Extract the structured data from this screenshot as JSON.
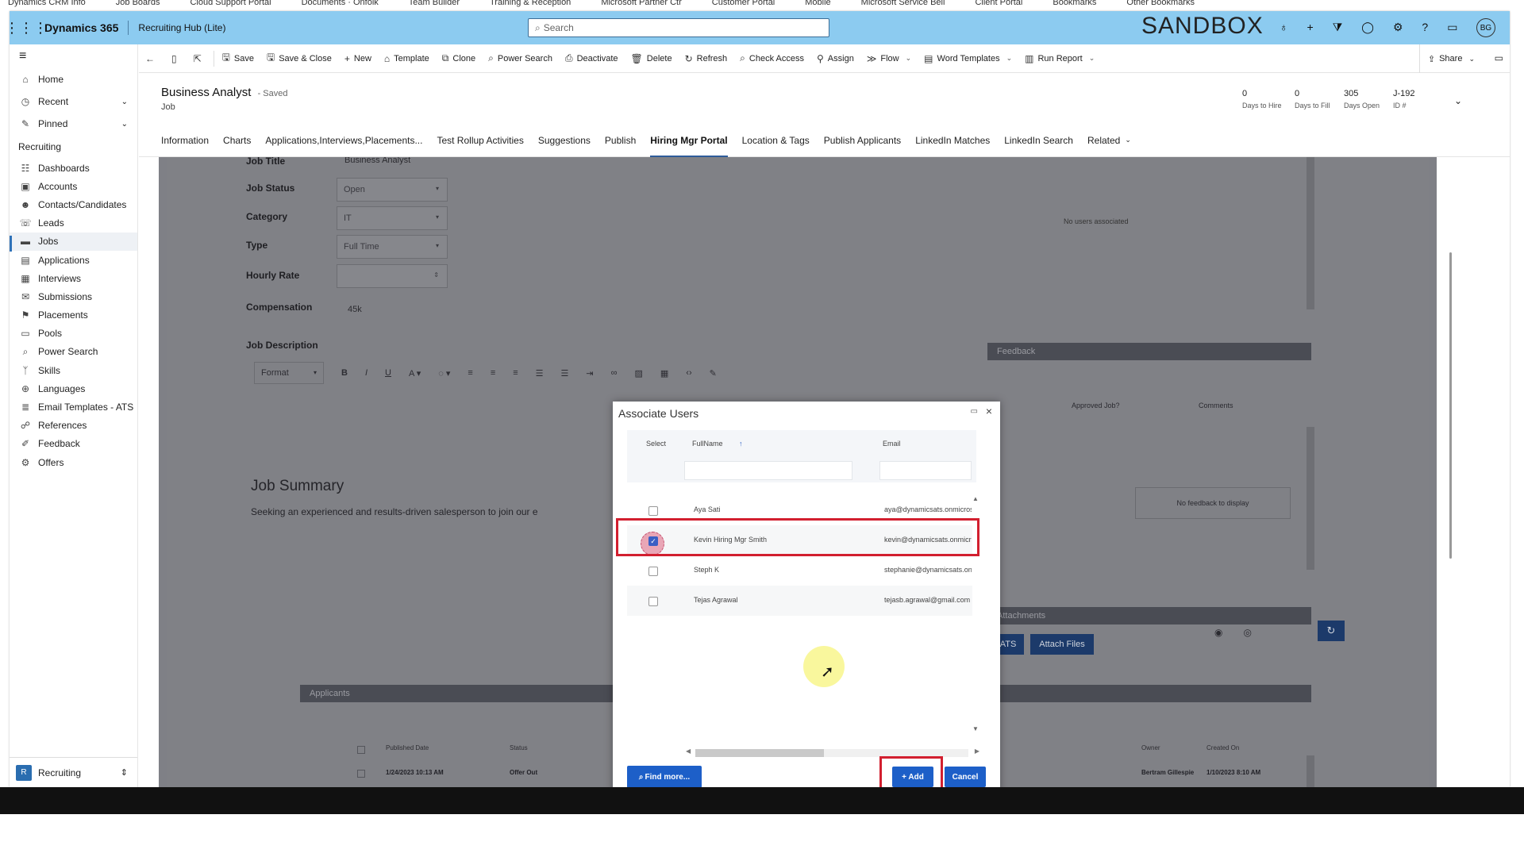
{
  "bookmarks": [
    "Dynamics CRM Info",
    "Job Boards",
    "Cloud Support Portal",
    "Documents · Onfolk",
    "Team Builder",
    "Training & Reception",
    "Microsoft Partner Ctr",
    "Customer Portal",
    "Mobile",
    "Microsoft Service Bell",
    "Client Portal",
    "Bookmarks",
    "Other Bookmarks"
  ],
  "topbar": {
    "brand": "Dynamics 365",
    "app_name": "Recruiting Hub (Lite)",
    "search_placeholder": "Search",
    "environment": "SANDBOX",
    "avatar_initials": "BG",
    "icons": [
      "lightbulb-icon",
      "plus-icon",
      "filter-icon",
      "bell-icon",
      "gear-icon",
      "help-icon",
      "chat-icon"
    ]
  },
  "sidebar": {
    "top": [
      {
        "label": "Home",
        "icon": "⌂",
        "name": "home"
      },
      {
        "label": "Recent",
        "icon": "◷",
        "name": "recent",
        "chevron": "⌄"
      },
      {
        "label": "Pinned",
        "icon": "✎",
        "name": "pinned",
        "chevron": "⌄"
      }
    ],
    "group_label": "Recruiting",
    "items": [
      {
        "label": "Dashboards",
        "icon": "☷",
        "name": "dashboards"
      },
      {
        "label": "Accounts",
        "icon": "▣",
        "name": "accounts"
      },
      {
        "label": "Contacts/Candidates",
        "icon": "☻",
        "name": "contacts-candidates"
      },
      {
        "label": "Leads",
        "icon": "☏",
        "name": "leads"
      },
      {
        "label": "Jobs",
        "icon": "▬",
        "name": "jobs",
        "active": true
      },
      {
        "label": "Applications",
        "icon": "▤",
        "name": "applications"
      },
      {
        "label": "Interviews",
        "icon": "▦",
        "name": "interviews"
      },
      {
        "label": "Submissions",
        "icon": "✉",
        "name": "submissions"
      },
      {
        "label": "Placements",
        "icon": "⚑",
        "name": "placements"
      },
      {
        "label": "Pools",
        "icon": "▭",
        "name": "pools"
      },
      {
        "label": "Power Search",
        "icon": "⌕",
        "name": "power-search"
      },
      {
        "label": "Skills",
        "icon": "ᛉ",
        "name": "skills"
      },
      {
        "label": "Languages",
        "icon": "⊕",
        "name": "languages"
      },
      {
        "label": "Email Templates - ATS",
        "icon": "≣",
        "name": "email-templates"
      },
      {
        "label": "References",
        "icon": "☍",
        "name": "references"
      },
      {
        "label": "Feedback",
        "icon": "✐",
        "name": "feedback"
      },
      {
        "label": "Offers",
        "icon": "⚙",
        "name": "offers"
      }
    ],
    "area": {
      "badge": "R",
      "label": "Recruiting",
      "chevron": "⇕"
    }
  },
  "commandbar": [
    {
      "label": "",
      "icon": "←",
      "name": "back"
    },
    {
      "label": "",
      "icon": "▯",
      "name": "record-icon-btn"
    },
    {
      "label": "",
      "icon": "⇱",
      "name": "popout"
    },
    {
      "label": "Save",
      "icon": "🖫",
      "name": "save"
    },
    {
      "label": "Save & Close",
      "icon": "🖫",
      "name": "save-close"
    },
    {
      "label": "New",
      "icon": "+",
      "name": "new"
    },
    {
      "label": "Template",
      "icon": "⌂",
      "name": "template"
    },
    {
      "label": "Clone",
      "icon": "⧉",
      "name": "clone"
    },
    {
      "label": "Power Search",
      "icon": "⌕",
      "name": "power-search"
    },
    {
      "label": "Deactivate",
      "icon": "⎙",
      "name": "deactivate"
    },
    {
      "label": "Delete",
      "icon": "🗑",
      "name": "delete"
    },
    {
      "label": "Refresh",
      "icon": "↻",
      "name": "refresh"
    },
    {
      "label": "Check Access",
      "icon": "⌕",
      "name": "check-access"
    },
    {
      "label": "Assign",
      "icon": "⚲",
      "name": "assign"
    },
    {
      "label": "Flow",
      "icon": "≫",
      "name": "flow",
      "dropdown": true
    },
    {
      "label": "Word Templates",
      "icon": "▤",
      "name": "word-templates",
      "dropdown": true
    },
    {
      "label": "Run Report",
      "icon": "▥",
      "name": "run-report",
      "dropdown": true
    }
  ],
  "share": {
    "label": "Share",
    "icon": "⇪"
  },
  "record": {
    "title": "Business Analyst",
    "saved": "- Saved",
    "entity": "Job",
    "kpis": [
      {
        "value": "0",
        "label": "Days to Hire"
      },
      {
        "value": "0",
        "label": "Days to Fill"
      },
      {
        "value": "305",
        "label": "Days Open"
      },
      {
        "value": "J-192",
        "label": "ID #"
      }
    ]
  },
  "tabs": [
    {
      "label": "Information"
    },
    {
      "label": "Charts"
    },
    {
      "label": "Applications,Interviews,Placements..."
    },
    {
      "label": "Test Rollup Activities"
    },
    {
      "label": "Suggestions"
    },
    {
      "label": "Publish"
    },
    {
      "label": "Hiring Mgr Portal",
      "active": true
    },
    {
      "label": "Location & Tags"
    },
    {
      "label": "Publish Applicants"
    },
    {
      "label": "LinkedIn Matches"
    },
    {
      "label": "LinkedIn Search"
    },
    {
      "label": "Related",
      "dropdown": true
    }
  ],
  "form": {
    "job_title_label": "Job Title",
    "job_title_value": "Business Analyst",
    "job_status_label": "Job Status",
    "job_status_value": "Open",
    "category_label": "Category",
    "category_value": "IT",
    "type_label": "Type",
    "type_value": "Full Time",
    "hourly_rate_label": "Hourly Rate",
    "compensation_label": "Compensation",
    "compensation_value": "45k",
    "job_description_label": "Job Description",
    "rte_format": "Format",
    "job_summary_title": "Job Summary",
    "job_summary_text": "Seeking an experienced and results-driven salesperson to join our e",
    "no_users": "No users associated",
    "feedback_header": "Feedback",
    "feedback_col_approved": "Approved Job?",
    "feedback_col_comments": "Comments",
    "no_feedback": "No feedback to display",
    "attachments_header": "Attachments",
    "ats_button": "ATS",
    "attach_files_button": "Attach Files",
    "applicants_header": "Applicants",
    "applicants_cols": [
      "Published Date",
      "Status",
      "Owner",
      "Created On"
    ],
    "applicants_row": [
      "1/24/2023 10:13 AM",
      "Offer Out",
      "Bertram Gillespie",
      "1/10/2023 8:10 AM"
    ]
  },
  "dialog": {
    "title": "Associate Users",
    "col_select": "Select",
    "col_fullname": "FullName",
    "col_email": "Email",
    "sort_icon": "↑",
    "rows": [
      {
        "name": "Aya Sati",
        "email": "aya@dynamicsats.onmicrosoft.com",
        "checked": false
      },
      {
        "name": "Kevin Hiring Mgr Smith",
        "email": "kevin@dynamicsats.onmicrosoft.com",
        "checked": true
      },
      {
        "name": "Steph K",
        "email": "stephanie@dynamicsats.onmicrosoft.com",
        "checked": false
      },
      {
        "name": "Tejas Agrawal",
        "email": "tejasb.agrawal@gmail.com",
        "checked": false
      }
    ],
    "find_more": "Find more...",
    "add": "+ Add",
    "cancel": "Cancel"
  }
}
